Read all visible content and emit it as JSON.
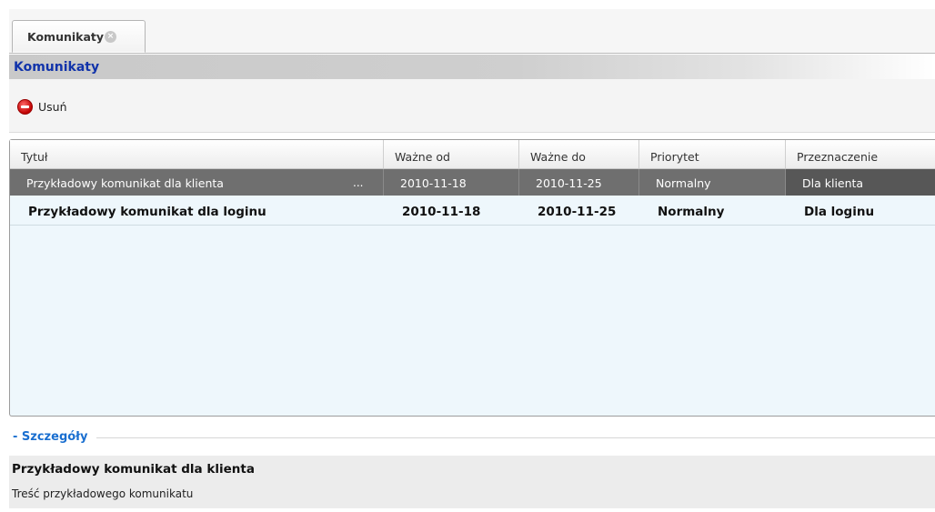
{
  "tab": {
    "label": "Komunikaty",
    "close_glyph": "×"
  },
  "panel": {
    "title": "Komunikaty"
  },
  "toolbar": {
    "delete_label": "Usuń",
    "delete_icon": "delete-icon"
  },
  "grid": {
    "columns": [
      "Tytuł",
      "Ważne od",
      "Ważne do",
      "Priorytet",
      "Przeznaczenie"
    ],
    "rows": [
      {
        "title": "Przykładowy komunikat dla klienta",
        "ellipsis": "...",
        "from": "2010-11-18",
        "to": "2010-11-25",
        "priority": "Normalny",
        "target": "Dla klienta",
        "selected": true
      },
      {
        "title": "Przykładowy komunikat dla loginu",
        "from": "2010-11-18",
        "to": "2010-11-25",
        "priority": "Normalny",
        "target": "Dla loginu",
        "selected": false
      }
    ]
  },
  "details": {
    "label": "- Szczegóły",
    "title": "Przykładowy komunikat dla klienta",
    "text": "Treść przykładowego komunikatu"
  },
  "colors": {
    "panel_title": "#1133aa",
    "details_label": "#1a6fd0",
    "selected_row": "#6f6f6f",
    "grid_bg": "#eef7fc"
  }
}
